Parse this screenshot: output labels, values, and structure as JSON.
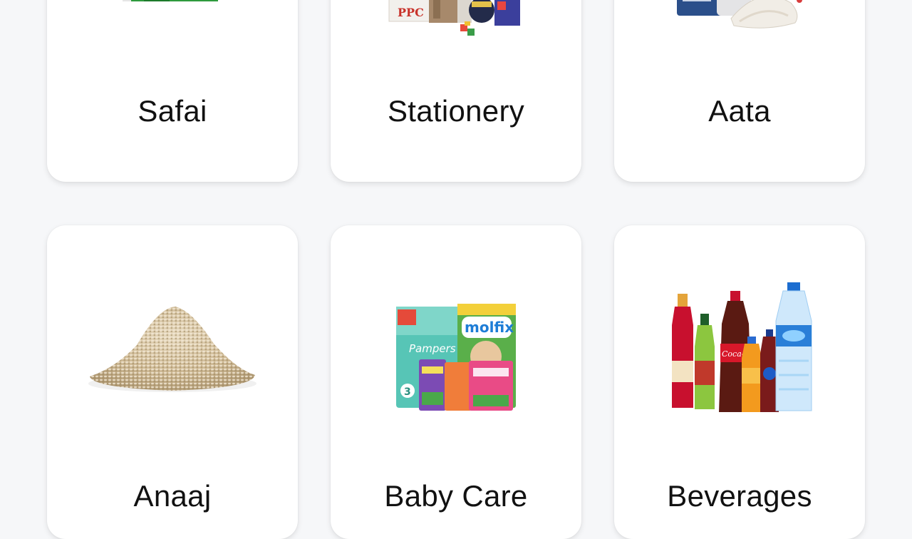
{
  "categories": [
    {
      "name": "Safai",
      "image": "cleaning-products-image"
    },
    {
      "name": "Stationery",
      "image": "stationery-products-image"
    },
    {
      "name": "Aata",
      "image": "flour-bags-image"
    },
    {
      "name": "Anaaj",
      "image": "grain-pile-image"
    },
    {
      "name": "Baby Care",
      "image": "diaper-packs-image"
    },
    {
      "name": "Beverages",
      "image": "drink-bottles-image"
    }
  ]
}
